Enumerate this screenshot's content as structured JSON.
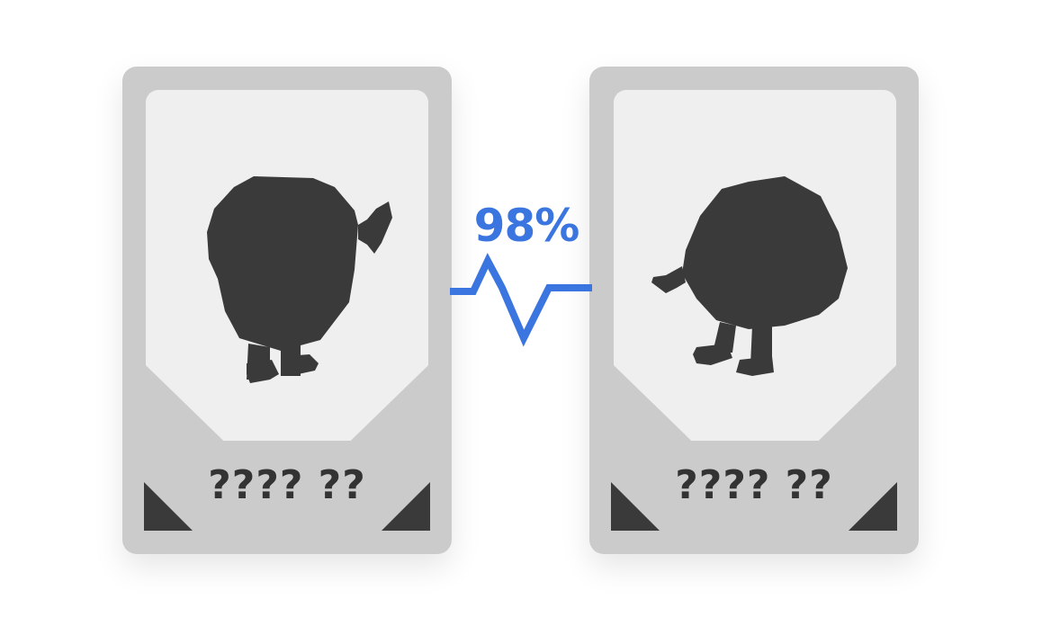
{
  "cards": [
    {
      "name": "???? ??",
      "icon": "creature-silhouette-icon"
    },
    {
      "name": "???? ??",
      "icon": "creature-silhouette-icon"
    }
  ],
  "match": {
    "percent_label": "98%",
    "value": 0.98,
    "color": "#3a75e0"
  },
  "colors": {
    "card_frame": "#cbcbcb",
    "card_panel": "#efefef",
    "silhouette": "#3a3a3a",
    "text": "#333333"
  }
}
